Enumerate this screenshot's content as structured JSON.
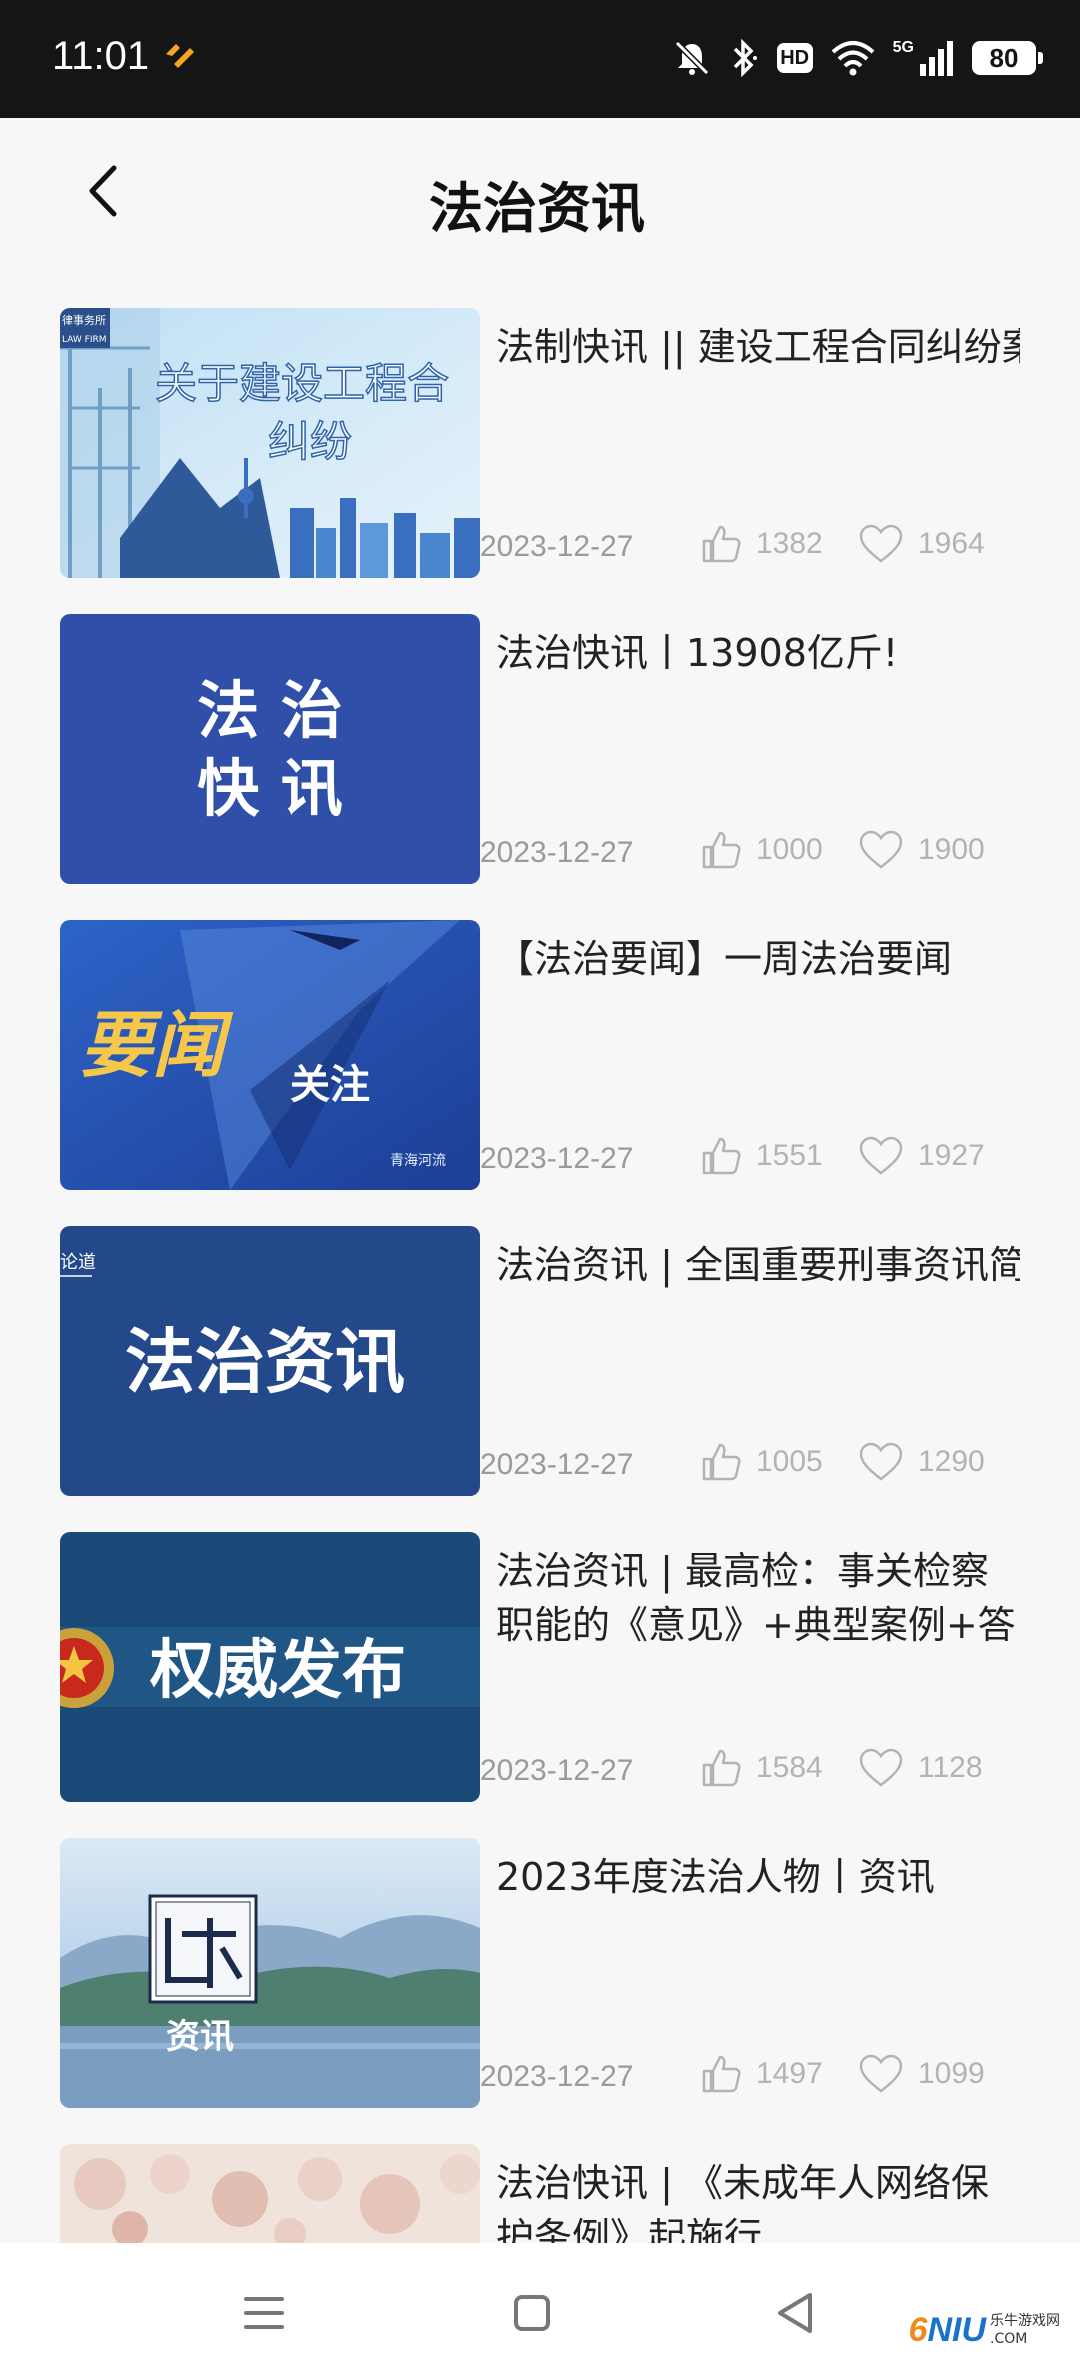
{
  "status_bar": {
    "time": "11:01",
    "network": "5G",
    "hd": "HD",
    "battery": "80"
  },
  "header": {
    "title": "法治资讯"
  },
  "articles": [
    {
      "title": "法制快讯 || 建设工程合同纠纷案",
      "thumb_text": [
        "关于建设工程合",
        "纠纷"
      ],
      "thumb_small": "律事务所",
      "thumb_small2": "LAW FIRM",
      "date": "2023-12-27",
      "likes": "1382",
      "favorites": "1964"
    },
    {
      "title": "法治快讯丨13908亿斤!",
      "thumb_text": [
        "法 治",
        "快 讯"
      ],
      "date": "2023-12-27",
      "likes": "1000",
      "favorites": "1900"
    },
    {
      "title": "【法治要闻】一周法治要闻",
      "thumb_text": [
        "要闻",
        "关注"
      ],
      "thumb_small": "青海河流",
      "date": "2023-12-27",
      "likes": "1551",
      "favorites": "1927"
    },
    {
      "title": "法治资讯 | 全国重要刑事资讯简报",
      "thumb_text": [
        "法治资讯"
      ],
      "thumb_small": "论道",
      "date": "2023-12-27",
      "likes": "1005",
      "favorites": "1290"
    },
    {
      "title": "法治资讯 | 最高检：事关检察职能的《意见》+典型案例+答记者问",
      "thumb_text": [
        "权威发布"
      ],
      "date": "2023-12-27",
      "likes": "1584",
      "favorites": "1128"
    },
    {
      "title": "2023年度法治人物丨资讯",
      "thumb_text": [
        "资讯"
      ],
      "date": "2023-12-27",
      "likes": "1497",
      "favorites": "1099"
    },
    {
      "title": "法治快讯 | 《未成年人网络保护条例》起施行",
      "date": "",
      "likes": "",
      "favorites": ""
    }
  ],
  "watermark": {
    "logo_a": "6",
    "logo_b": "NIU",
    "site": "乐牛游戏网",
    "domain": ".COM"
  },
  "colors": {
    "accent_orange": "#f5a623",
    "stat_gray": "#b3b3b3",
    "date_gray": "#9a9a9a"
  }
}
